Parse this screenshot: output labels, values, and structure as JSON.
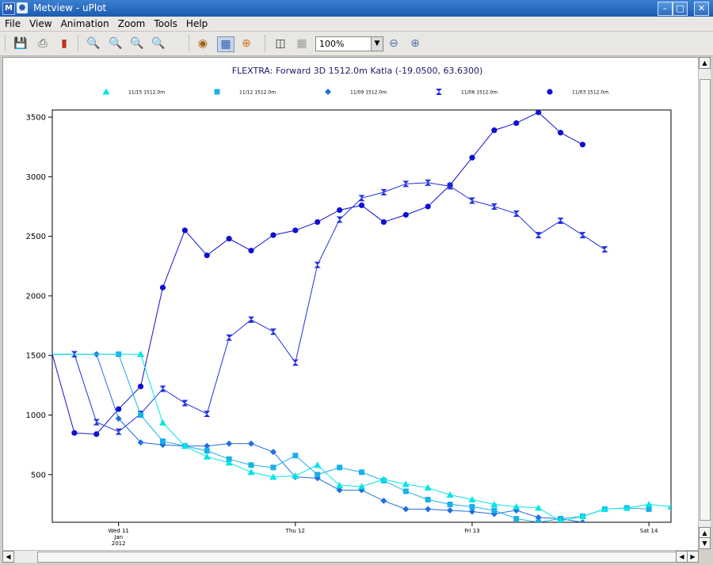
{
  "window": {
    "title": "Metview - uPlot"
  },
  "menu": [
    "File",
    "View",
    "Animation",
    "Zoom",
    "Tools",
    "Help"
  ],
  "toolbar": {
    "zoom_value": "100%"
  },
  "chart_data": {
    "type": "line",
    "title": "FLEXTRA: Forward 3D 1512.0m Katla (-19.0500, 63.6300)",
    "xlabel": "",
    "ylabel": "",
    "ylim": [
      100,
      3560
    ],
    "y_ticks": [
      500,
      1000,
      1500,
      2000,
      2500,
      3000,
      3500
    ],
    "x_tick_labels": [
      {
        "slot": 3,
        "lines": [
          "Wed 11",
          "Jan",
          "2012"
        ]
      },
      {
        "slot": 11,
        "lines": [
          "Thu 12"
        ]
      },
      {
        "slot": 19,
        "lines": [
          "Fri 13"
        ]
      },
      {
        "slot": 27,
        "lines": [
          "Sat 14"
        ]
      }
    ],
    "x_range": [
      0,
      28
    ],
    "grid": false,
    "legend_position": "top",
    "series": [
      {
        "name": "11/15 1512.0m",
        "marker": "triangle",
        "color": "#00e5e5",
        "start_slot": 4,
        "values": [
          1510,
          935,
          740,
          650,
          600,
          520,
          480,
          490,
          580,
          410,
          400,
          460,
          420,
          390,
          330,
          290,
          250,
          230,
          220,
          110,
          150,
          210,
          220,
          250,
          230
        ]
      },
      {
        "name": "11/12 1512.0m",
        "marker": "square",
        "color": "#1ab0e8",
        "start_slot": 3,
        "values": [
          1510,
          1000,
          780,
          740,
          700,
          630,
          580,
          560,
          660,
          500,
          560,
          520,
          450,
          360,
          290,
          250,
          230,
          200,
          130,
          100,
          130,
          150,
          210,
          220,
          210
        ]
      },
      {
        "name": "11/09 1512.0m",
        "marker": "diamond",
        "color": "#1f6fe0",
        "start_slot": 2,
        "values": [
          1510,
          970,
          770,
          750,
          740,
          740,
          760,
          760,
          690,
          480,
          470,
          370,
          370,
          280,
          210,
          210,
          200,
          190,
          170,
          200,
          140,
          130,
          100
        ]
      },
      {
        "name": "11/06 1512.0m",
        "marker": "hourglass",
        "color": "#2030e0",
        "start_slot": 1,
        "values": [
          1510,
          940,
          860,
          1010,
          1220,
          1100,
          1010,
          1650,
          1800,
          1700,
          1440,
          2260,
          2640,
          2820,
          2870,
          2940,
          2950,
          2920,
          2800,
          2750,
          2690,
          2510,
          2630,
          2510,
          2390
        ]
      },
      {
        "name": "11/03 1512.0m",
        "marker": "circle",
        "color": "#1010d0",
        "start_slot": 1,
        "values": [
          850,
          840,
          1050,
          1240,
          2070,
          2550,
          2340,
          2480,
          2380,
          2510,
          2550,
          2620,
          2720,
          2760,
          2620,
          2680,
          2750,
          2930,
          3160,
          3390,
          3450,
          3540,
          3370,
          3270
        ]
      }
    ]
  }
}
